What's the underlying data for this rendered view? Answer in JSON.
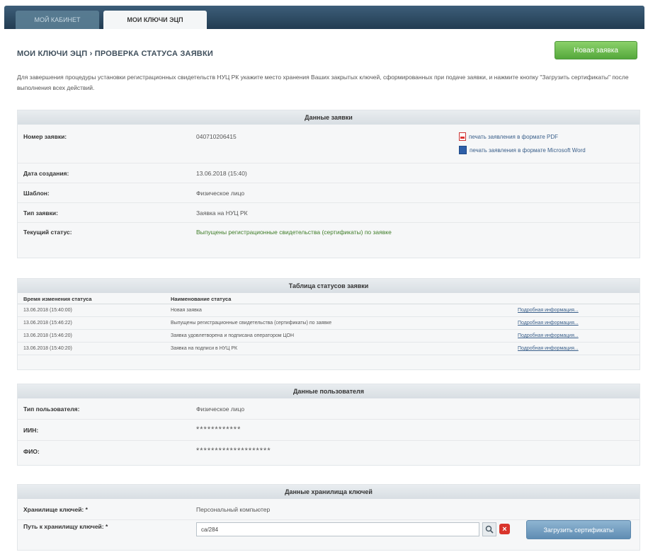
{
  "tabs": [
    {
      "label": "Мой кабинет",
      "active": false
    },
    {
      "label": "Мои ключи ЭЦП",
      "active": true
    }
  ],
  "breadcrumb": "Мои ключи ЭЦП › Проверка статуса заявки",
  "new_request_button": "Новая заявка",
  "intro_text": "Для завершения процедуры установки регистрационных свидетельств НУЦ РК укажите место хранения Ваших закрытых ключей, сформированных при подаче заявки, и нажмите кнопку \"Загрузить сертификаты\" после выполнения всех действий.",
  "request": {
    "header": "Данные заявки",
    "number_label": "Номер заявки:",
    "number_value": "040710206415",
    "pdf_link": "печать заявления в формате PDF",
    "word_link": "печать заявления в формате Microsoft Word",
    "created_label": "Дата создания:",
    "created_value": "13.06.2018 (15:40)",
    "template_label": "Шаблон:",
    "template_value": "Физическое лицо",
    "type_label": "Тип заявки:",
    "type_value": "Заявка на НУЦ РК",
    "status_label": "Текущий статус:",
    "status_value": "Выпущены регистрационные свидетельства (сертификаты) по заявке",
    "help": "?"
  },
  "history": {
    "header": "Таблица статусов заявки",
    "col_time": "Время изменения статуса",
    "col_name": "Наименование статуса",
    "more_label": "Подробная информация...",
    "rows": [
      {
        "time": "13.06.2018 (15:40:00)",
        "name": "Новая заявка"
      },
      {
        "time": "13.06.2018 (15:46:22)",
        "name": "Выпущены регистрационные свидетельства (сертификаты) по заявке"
      },
      {
        "time": "13.06.2018 (15:46:20)",
        "name": "Заявка удовлетворена и подписана оператором ЦОН"
      },
      {
        "time": "13.06.2018 (15:40:20)",
        "name": "Заявка на подписи в НУЦ РК"
      }
    ]
  },
  "user": {
    "header": "Данные пользователя",
    "type_label": "Тип пользователя:",
    "type_value": "Физическое лицо",
    "iin_label": "ИИН:",
    "iin_value": "************",
    "fio_label": "ФИО:",
    "fio_value": "********************"
  },
  "storage": {
    "header": "Данные хранилища ключей",
    "type_label": "Хранилище ключей: *",
    "type_value": "Персональный компьютер",
    "path_label": "Путь к хранилищу ключей: *",
    "path_value": "ca/284",
    "load_button": "Загрузить сертификаты"
  }
}
